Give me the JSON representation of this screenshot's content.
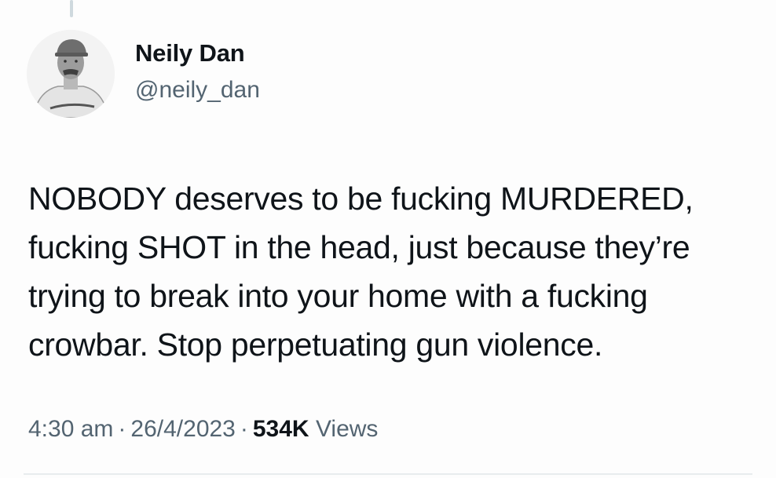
{
  "author": {
    "display_name": "Neily Dan",
    "handle": "@neily_dan"
  },
  "tweet": {
    "text": "NOBODY deserves to be fucking MURDERED,\nfucking SHOT in the head, just because they’re\ntrying to break into your home with a fucking\ncrowbar. Stop perpetuating gun violence.",
    "time": "4:30 am",
    "date": "26/4/2023",
    "separator": "·",
    "views_count": "534K",
    "views_label": "Views"
  },
  "icons": {
    "avatar": "profile-photo-man-with-cap"
  }
}
